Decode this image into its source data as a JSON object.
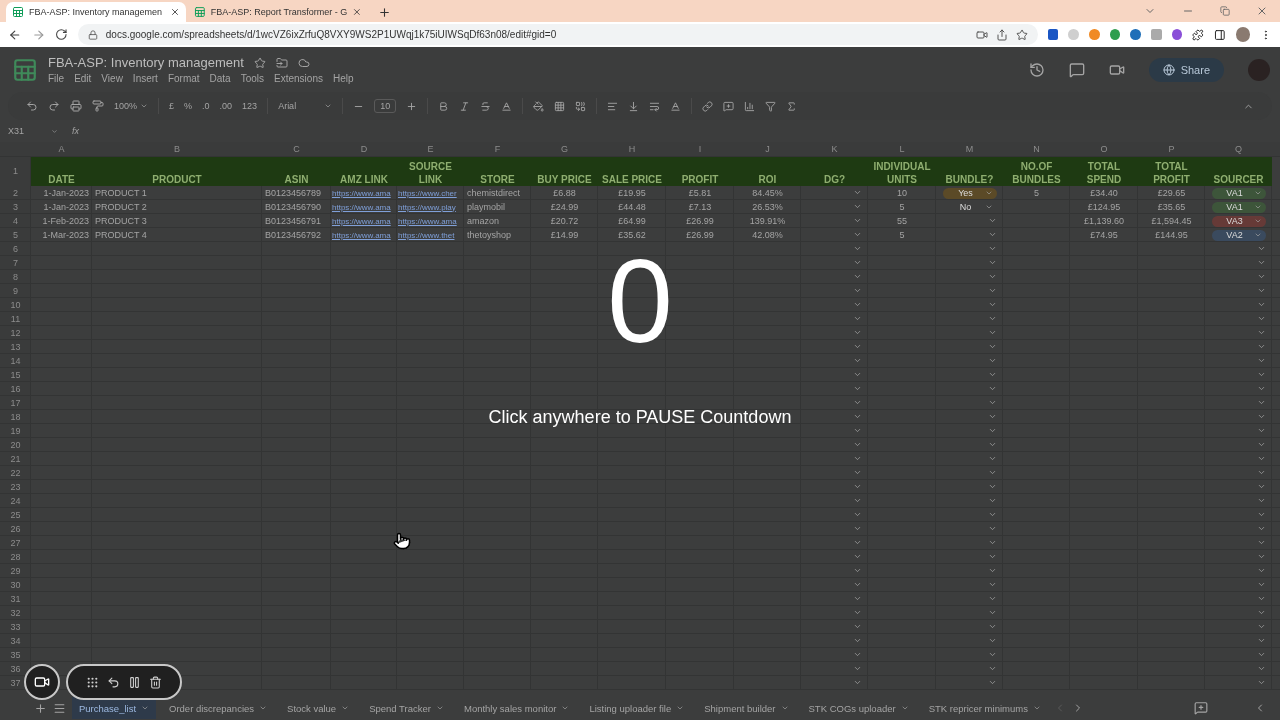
{
  "browser": {
    "tabs": [
      {
        "title": "FBA-ASP: Inventory managemen",
        "selected": true
      },
      {
        "title": "FBA-ASP: Report Transformer - G",
        "selected": false
      }
    ],
    "url": "docs.google.com/spreadsheets/d/1wcVZ6ixZrfuQ8VXY9WS2P1UWqj1k75iUIWSqDf63n08/edit#gid=0"
  },
  "doc": {
    "title": "FBA-ASP: Inventory management",
    "menu": [
      "File",
      "Edit",
      "View",
      "Insert",
      "Format",
      "Data",
      "Tools",
      "Extensions",
      "Help"
    ],
    "share": "Share"
  },
  "toolbar": {
    "zoom": "100%",
    "currency": "£",
    "percent": "%",
    "decrease_decimal": ".0",
    "increase_decimal": ".00",
    "number_format": "123",
    "font": "Arial",
    "font_size": "10"
  },
  "formula_bar": {
    "cell_ref": "X31",
    "fx": "fx"
  },
  "sheet": {
    "column_letters": [
      "A",
      "B",
      "C",
      "D",
      "E",
      "F",
      "G",
      "H",
      "I",
      "J",
      "K",
      "L",
      "M",
      "N",
      "O",
      "P",
      "Q"
    ],
    "header_row": "1",
    "headers": [
      "DATE",
      "PRODUCT",
      "ASIN",
      "AMZ LINK",
      "SOURCE LINK",
      "STORE",
      "BUY PRICE",
      "SALE PRICE",
      "PROFIT",
      "ROI",
      "DG?",
      "INDIVIDUAL UNITS",
      "BUNDLE?",
      "NO.OF BUNDLES",
      "TOTAL SPEND",
      "TOTAL PROFIT",
      "SOURCER"
    ],
    "rows": [
      {
        "number": "2",
        "date": "1-Jan-2023",
        "product": "PRODUCT 1",
        "asin": "B0123456789",
        "amz_link": "https://www.ama",
        "source_link": "https://www.cher",
        "store": "chemistdirect",
        "buy_price": "£6.88",
        "sale_price": "£19.95",
        "profit": "£5.81",
        "roi": "84.45%",
        "units": "10",
        "bundle": {
          "value": "Yes",
          "color": "#5b4a27"
        },
        "bundles": "5",
        "total_spend": "£34.40",
        "total_profit": "£29.65",
        "sourcer": {
          "value": "VA1",
          "color": "#3d553a"
        }
      },
      {
        "number": "3",
        "date": "1-Jan-2023",
        "product": "PRODUCT 2",
        "asin": "B0123456790",
        "amz_link": "https://www.ama",
        "source_link": "https://www.play",
        "store": "playmobil",
        "buy_price": "£24.99",
        "sale_price": "£44.48",
        "profit": "£7.13",
        "roi": "26.53%",
        "units": "5",
        "bundle": {
          "value": "No"
        },
        "total_spend": "£124.95",
        "total_profit": "£35.65",
        "sourcer": {
          "value": "VA1",
          "color": "#3d553a"
        }
      },
      {
        "number": "4",
        "date": "1-Feb-2023",
        "product": "PRODUCT 3",
        "asin": "B0123456791",
        "amz_link": "https://www.ama",
        "source_link": "https://www.ama",
        "store": "amazon",
        "buy_price": "£20.72",
        "sale_price": "£64.99",
        "profit": "£26.99",
        "roi": "139.91%",
        "units": "55",
        "total_spend": "£1,139.60",
        "total_profit": "£1,594.45",
        "sourcer": {
          "value": "VA3",
          "color": "#663a37"
        }
      },
      {
        "number": "5",
        "date": "1-Mar-2023",
        "product": "PRODUCT 4",
        "asin": "B0123456792",
        "amz_link": "https://www.ama",
        "source_link": "https://www.thet",
        "store": "thetoyshop",
        "buy_price": "£14.99",
        "sale_price": "£35.62",
        "profit": "£26.99",
        "roi": "42.08%",
        "units": "5",
        "total_spend": "£74.95",
        "total_profit": "£144.95",
        "sourcer": {
          "value": "VA2",
          "color": "#3a4a5e"
        }
      }
    ],
    "empty_rows": [
      "6",
      "7",
      "8",
      "9",
      "10",
      "11",
      "12",
      "13",
      "14",
      "15",
      "16",
      "17",
      "18",
      "19",
      "20",
      "21",
      "22",
      "23",
      "24",
      "25",
      "26",
      "27",
      "28",
      "29",
      "30",
      "31",
      "32",
      "33",
      "34",
      "35",
      "36",
      "37"
    ]
  },
  "countdown": {
    "value": "0",
    "hint": "Click anywhere to PAUSE Countdown"
  },
  "sheet_tabs": [
    {
      "label": "Purchase_list",
      "selected": true
    },
    {
      "label": "Order discrepancies",
      "selected": false
    },
    {
      "label": "Stock value",
      "selected": false
    },
    {
      "label": "Spend Tracker",
      "selected": false
    },
    {
      "label": "Monthly sales monitor",
      "selected": false
    },
    {
      "label": "Listing uploader file",
      "selected": false
    },
    {
      "label": "Shipment builder",
      "selected": false
    },
    {
      "label": "STK COGs uploader",
      "selected": false
    },
    {
      "label": "STK repricer minimums",
      "selected": false
    }
  ]
}
